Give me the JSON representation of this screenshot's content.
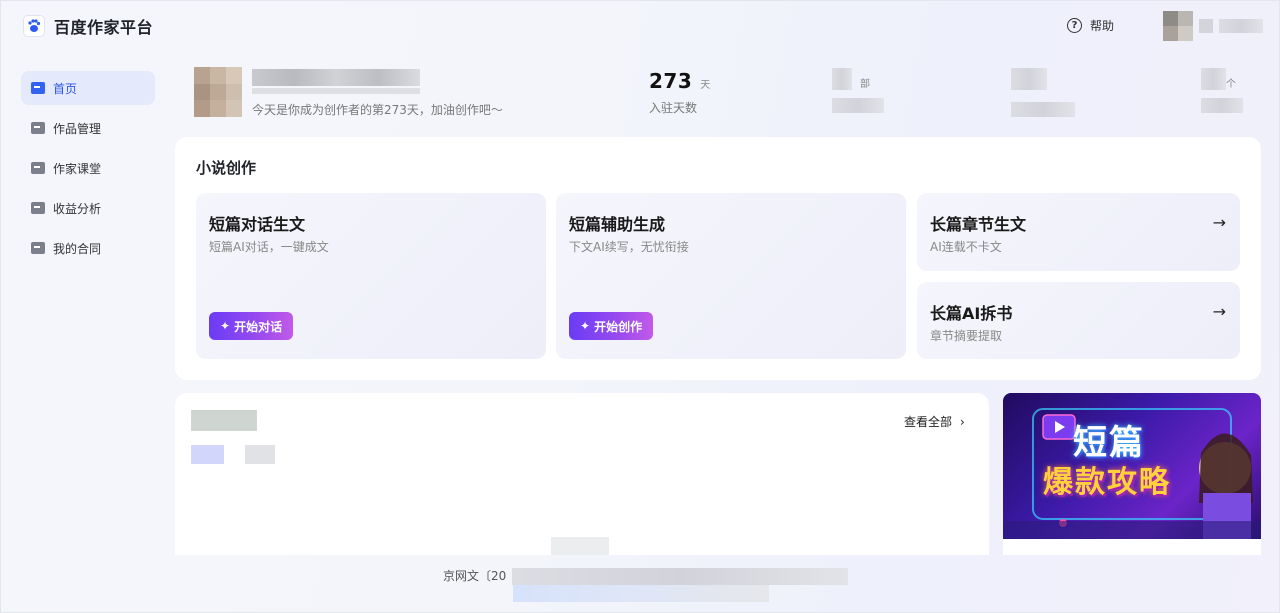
{
  "app": {
    "title": "百度作家平台"
  },
  "header": {
    "help_label": "帮助"
  },
  "sidebar": {
    "items": [
      {
        "label": "首页",
        "icon": "home-icon",
        "active": true
      },
      {
        "label": "作品管理",
        "icon": "works-icon",
        "active": false
      },
      {
        "label": "作家课堂",
        "icon": "classroom-icon",
        "active": false
      },
      {
        "label": "收益分析",
        "icon": "income-icon",
        "active": false
      },
      {
        "label": "我的合同",
        "icon": "contract-icon",
        "active": false
      }
    ]
  },
  "profile": {
    "greeting": "今天是你成为创作者的第273天，加油创作吧～"
  },
  "stats": {
    "days": {
      "value": "273",
      "unit": "天",
      "label": "入驻天数"
    },
    "works_unit": "部",
    "count_unit": "个"
  },
  "novel": {
    "section_title": "小说创作",
    "cards": [
      {
        "title": "短篇对话生文",
        "desc": "短篇AI对话，一键成文",
        "button": "开始对话"
      },
      {
        "title": "短篇辅助生成",
        "desc": "下文AI续写，无忧衔接",
        "button": "开始创作"
      },
      {
        "title": "长篇章节生文",
        "desc": "AI连载不卡文"
      },
      {
        "title": "长篇AI拆书",
        "desc": "章节摘要提取"
      }
    ]
  },
  "list": {
    "view_all": "查看全部"
  },
  "banner": {
    "line1": "短篇",
    "line2": "爆款攻略"
  },
  "footer": {
    "text": "京网文〔20"
  },
  "colors": {
    "accent": "#3362f0",
    "button_start": "#6a3cf5",
    "button_end": "#c25ae8"
  }
}
